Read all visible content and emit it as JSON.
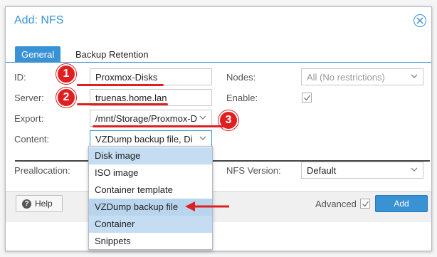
{
  "dialog": {
    "title": "Add: NFS",
    "tabs": [
      "General",
      "Backup Retention"
    ]
  },
  "form": {
    "id_label": "ID:",
    "id_value": "Proxmox-Disks",
    "server_label": "Server:",
    "server_value": "truenas.home.lan",
    "export_label": "Export:",
    "export_value": "/mnt/Storage/Proxmox-D",
    "content_label": "Content:",
    "content_value": "VZDump backup file, Di",
    "nodes_label": "Nodes:",
    "nodes_value": "All (No restrictions)",
    "enable_label": "Enable:",
    "enable_checked": true,
    "preallocation_label": "Preallocation:",
    "nfs_version_label": "NFS Version:",
    "nfs_version_value": "Default"
  },
  "content_dropdown": {
    "options": [
      "Disk image",
      "ISO image",
      "Container template",
      "VZDump backup file",
      "Container",
      "Snippets"
    ],
    "selected": [
      "Disk image",
      "VZDump backup file",
      "Container"
    ]
  },
  "footer": {
    "help_label": "Help",
    "advanced_label": "Advanced",
    "advanced_checked": true,
    "add_label": "Add"
  },
  "annotations": {
    "badges": [
      "1",
      "2",
      "3"
    ],
    "color": "#e02020"
  },
  "colors": {
    "accent": "#3892d4",
    "selected_row": "#c4ddf2"
  }
}
